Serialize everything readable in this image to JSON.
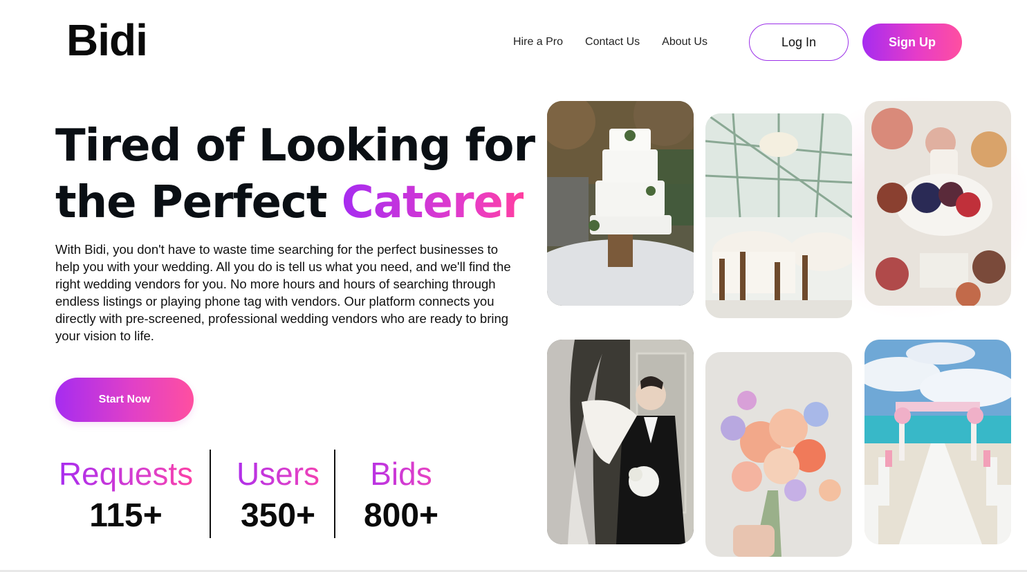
{
  "brand": {
    "logo": "Bidi"
  },
  "nav": {
    "items": [
      "Hire a Pro",
      "Contact Us",
      "About Us"
    ]
  },
  "auth": {
    "login_label": "Log In",
    "signup_label": "Sign Up"
  },
  "hero": {
    "title_line1": "Tired of Looking for",
    "title_line2_prefix": "the Perfect ",
    "title_highlight": "Caterer",
    "description": "With Bidi, you don't have to waste time searching for the perfect businesses to help you with your wedding. All you do is tell us what you need, and we'll find the right wedding vendors for you. No more hours and hours of searching through endless listings or playing phone tag with vendors. Our platform connects you directly with pre-screened, professional wedding vendors who are ready to bring your vision to life.",
    "cta_label": "Start Now"
  },
  "stats": [
    {
      "label": "Requests",
      "value": "115+"
    },
    {
      "label": "Users",
      "value": "350+"
    },
    {
      "label": "Bids",
      "value": "800+"
    }
  ],
  "gallery": [
    "wedding-cake-photo",
    "greenhouse-venue-photo",
    "charcuterie-board-photo",
    "bride-groom-photo",
    "flower-bouquet-photo",
    "beach-ceremony-photo"
  ],
  "colors": {
    "accent_start": "#a62cf0",
    "accent_end": "#ff4fa0",
    "text": "#0a0f14"
  }
}
